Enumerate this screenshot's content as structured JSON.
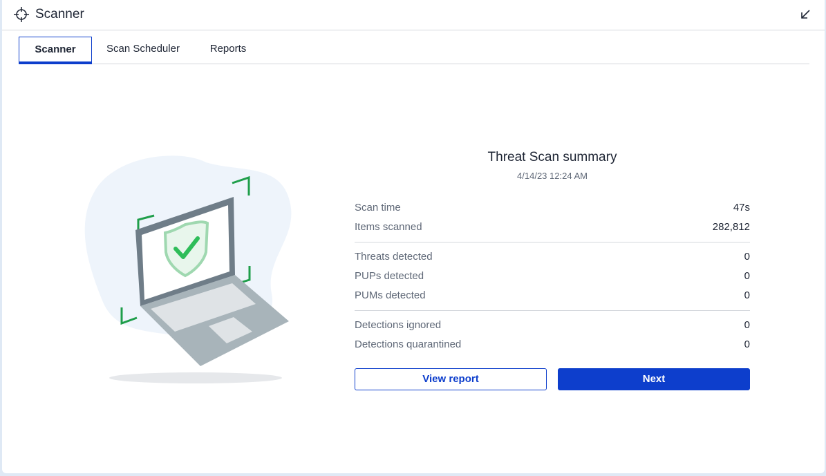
{
  "window": {
    "title": "Scanner",
    "title_icon": "crosshair-icon",
    "collapse_icon": "arrow-down-left-icon"
  },
  "tabs": [
    {
      "label": "Scanner",
      "active": true
    },
    {
      "label": "Scan Scheduler",
      "active": false
    },
    {
      "label": "Reports",
      "active": false
    }
  ],
  "illustration": {
    "icon": "laptop-shield-check-icon"
  },
  "summary": {
    "title": "Threat Scan summary",
    "date": "4/14/23 12:24 AM",
    "groups": [
      [
        {
          "label": "Scan time",
          "value": "47s"
        },
        {
          "label": "Items scanned",
          "value": "282,812"
        }
      ],
      [
        {
          "label": "Threats detected",
          "value": "0"
        },
        {
          "label": "PUPs detected",
          "value": "0"
        },
        {
          "label": "PUMs detected",
          "value": "0"
        }
      ],
      [
        {
          "label": "Detections ignored",
          "value": "0"
        },
        {
          "label": "Detections quarantined",
          "value": "0"
        }
      ]
    ]
  },
  "buttons": {
    "view_report": "View report",
    "next": "Next"
  },
  "colors": {
    "accent": "#0d3ecc",
    "shield_green": "#2ebd59",
    "bracket_green": "#1f9e4a",
    "laptop_gray": "#6f7d88",
    "blob": "#eef4fb"
  }
}
